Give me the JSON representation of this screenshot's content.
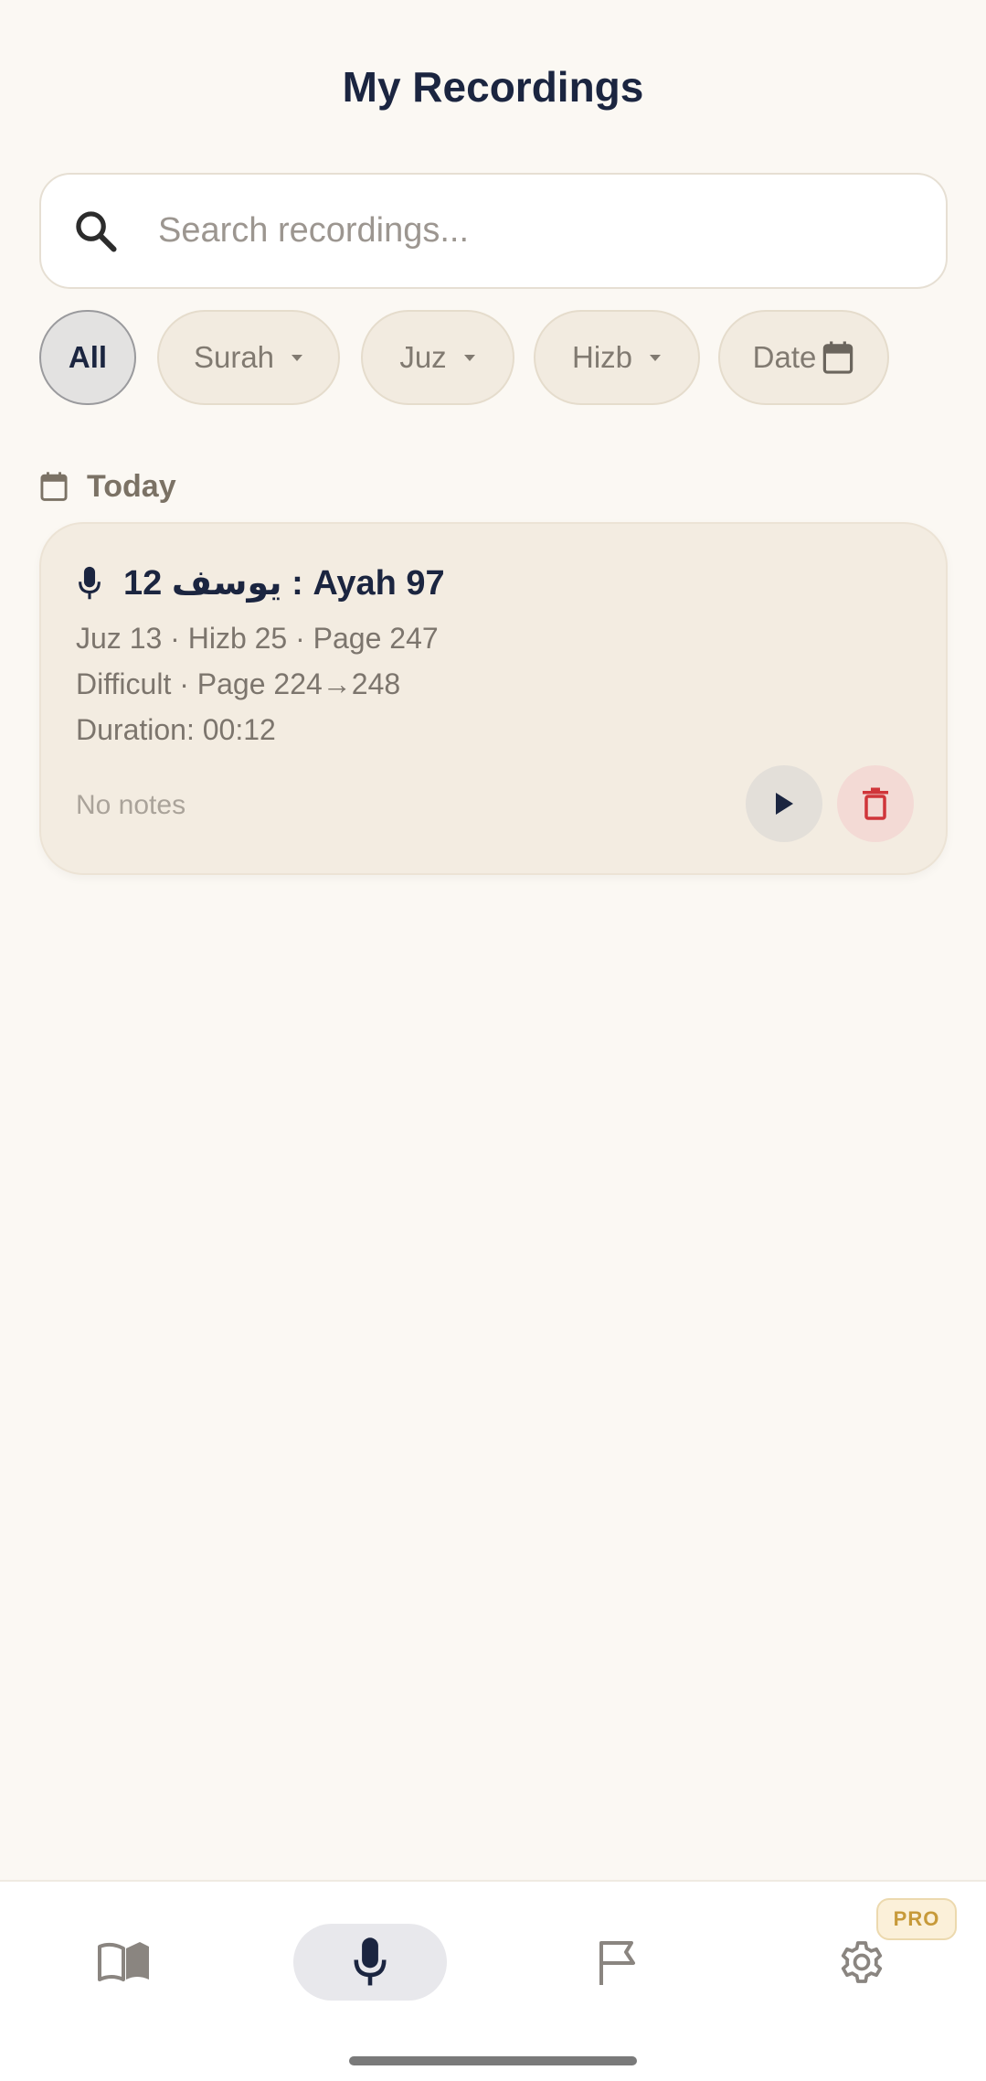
{
  "header": {
    "title": "My Recordings"
  },
  "search": {
    "placeholder": "Search recordings..."
  },
  "filters": {
    "all": "All",
    "surah": "Surah",
    "juz": "Juz",
    "hizb": "Hizb",
    "date": "Date"
  },
  "section": {
    "label": "Today"
  },
  "recording": {
    "title": "12 يوسف : Ayah 97",
    "location": "Juz 13 · Hizb 25 · Page 247",
    "difficulty": "Difficult · Page 224→248",
    "duration": "Duration: 00:12",
    "notes": "No notes"
  },
  "nav": {
    "items": [
      "book-icon",
      "mic-icon",
      "flag-icon",
      "gear-icon"
    ],
    "active": "mic-icon",
    "pro_badge": "PRO"
  },
  "colors": {
    "background": "#fbf8f3",
    "primary_text": "#1b2540",
    "card": "#f3ece1",
    "delete": "#d0353a",
    "pro": "#c79a3a"
  }
}
